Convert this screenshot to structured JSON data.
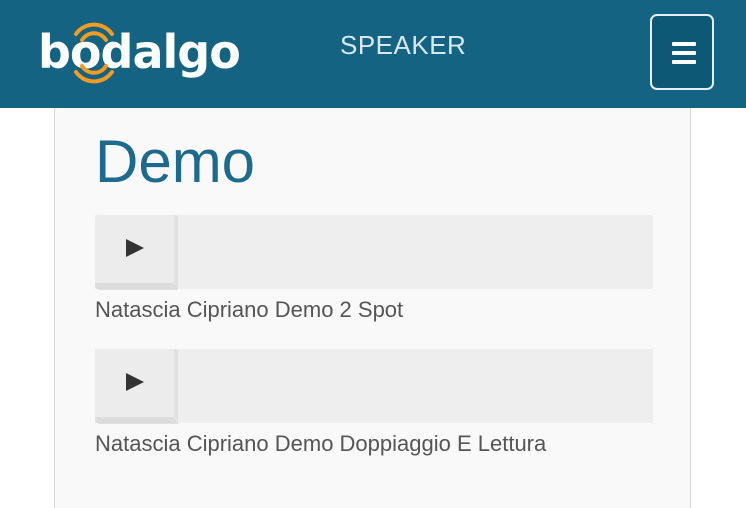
{
  "header": {
    "brand": "bodalgo",
    "section_title": "SPEAKER",
    "menu_icon": "hamburger-icon",
    "colors": {
      "background": "#146383",
      "logo_accent": "#f39c1f"
    }
  },
  "main": {
    "title": "Demo",
    "demos": [
      {
        "label": "Natascia Cipriano Demo 2 Spot",
        "play_icon": "play-icon"
      },
      {
        "label": "Natascia Cipriano Demo Doppiaggio E Lettura",
        "play_icon": "play-icon"
      }
    ]
  }
}
